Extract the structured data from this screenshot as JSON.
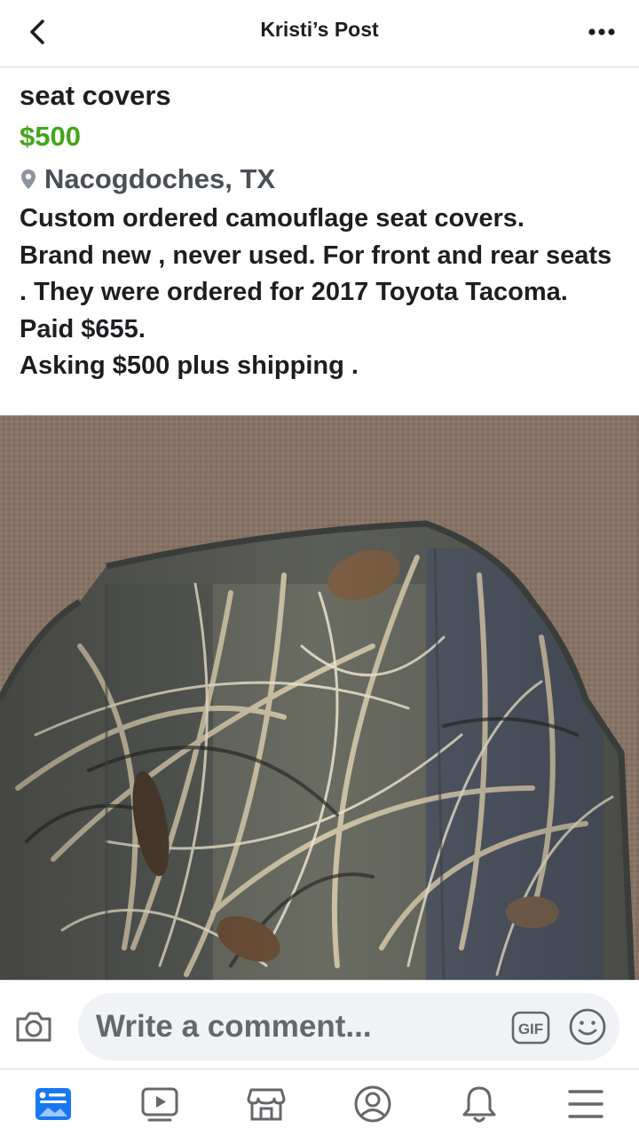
{
  "header": {
    "title": "Kristi’s Post",
    "back_icon": "chevron-left-icon",
    "more_icon": "more-dots-icon"
  },
  "listing": {
    "title": "seat covers",
    "price": "$500",
    "location": "Nacogdoches, TX",
    "description": "Custom ordered camouflage seat covers.\nBrand new , never used.  For front and rear seats . They were ordered for 2017 Toyota Tacoma. Paid $655.\nAsking $500 plus shipping .",
    "price_color": "#42a51b"
  },
  "composer": {
    "placeholder": "Write a comment...",
    "gif_label": "GIF",
    "camera_icon": "camera-icon",
    "emoji_icon": "emoji-icon"
  },
  "tabbar": {
    "items": [
      {
        "icon": "news-feed-icon",
        "active": true
      },
      {
        "icon": "watch-icon",
        "active": false
      },
      {
        "icon": "marketplace-icon",
        "active": false
      },
      {
        "icon": "profile-icon",
        "active": false
      },
      {
        "icon": "notifications-icon",
        "active": false
      },
      {
        "icon": "menu-icon",
        "active": false
      }
    ],
    "active_color": "#1877f2"
  }
}
